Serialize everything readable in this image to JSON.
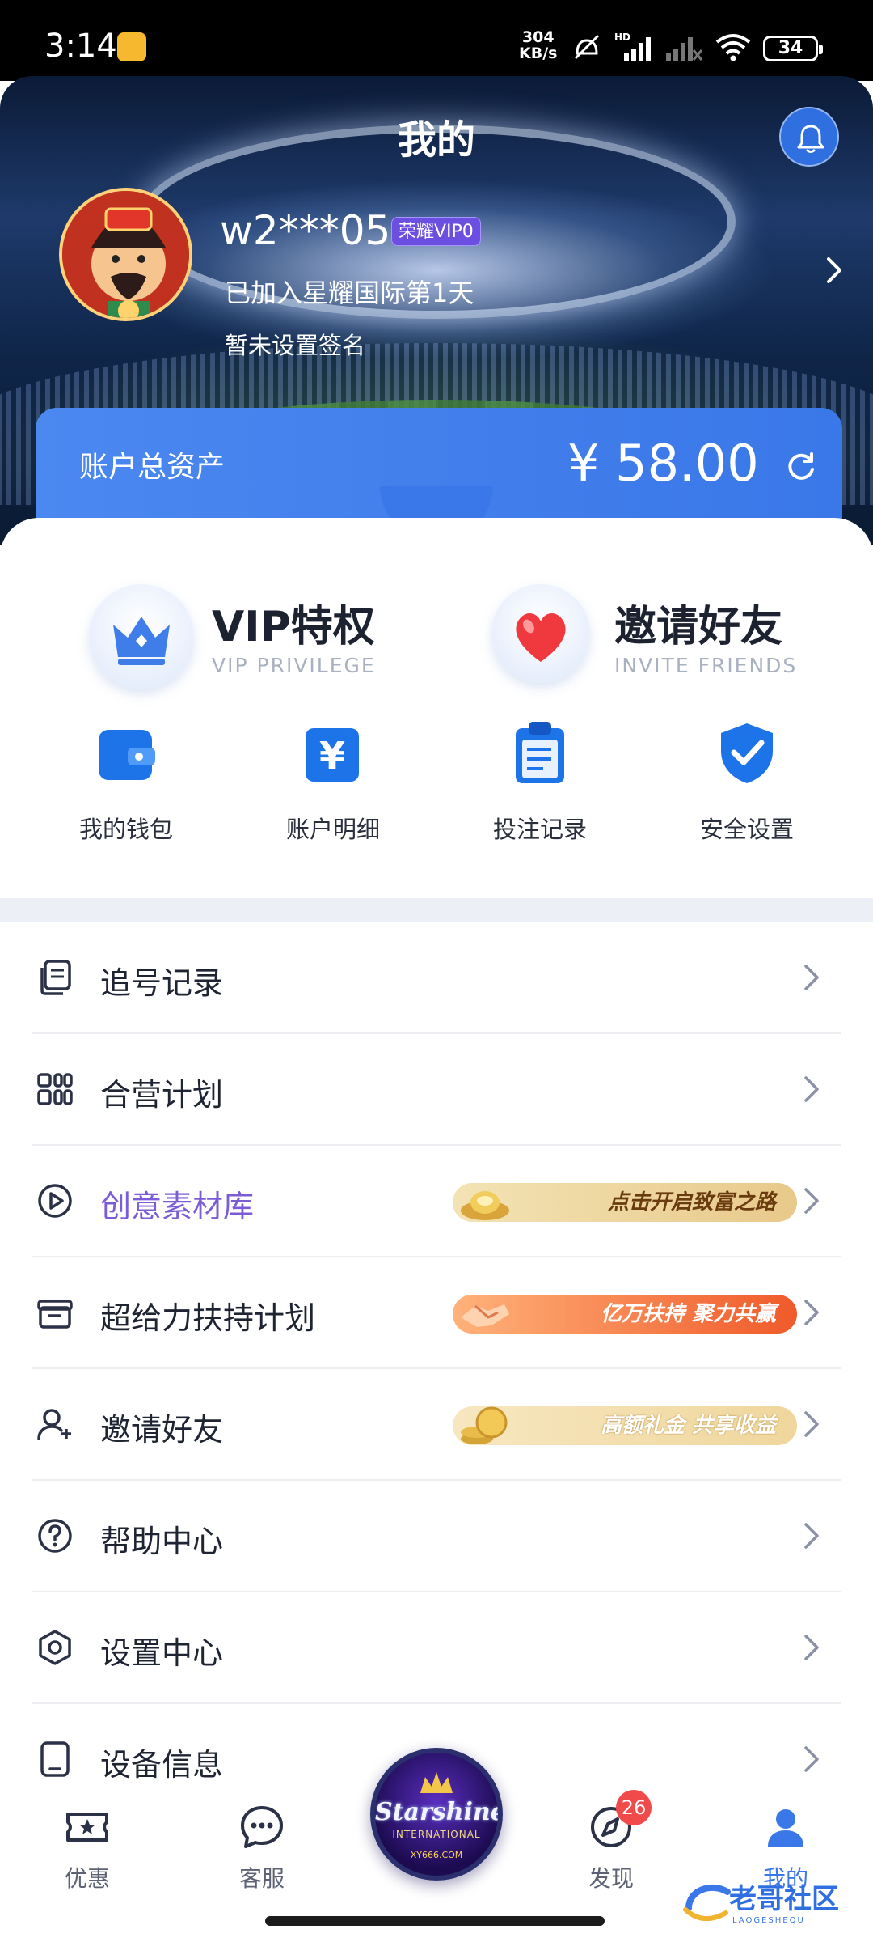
{
  "status_bar": {
    "time": "3:14",
    "speed_value": "304",
    "speed_unit": "KB/s",
    "battery": "34"
  },
  "header": {
    "title": "我的",
    "username": "w2***05",
    "vip_badge": "荣耀VIP0",
    "joined": "已加入星耀国际第1天",
    "signature": "暂未设置签名"
  },
  "asset": {
    "label": "账户总资产",
    "value": "¥ 58.00"
  },
  "features": [
    {
      "title": "VIP特权",
      "subtitle": "VIP PRIVILEGE",
      "icon": "crown-icon"
    },
    {
      "title": "邀请好友",
      "subtitle": "INVITE FRIENDS",
      "icon": "heart-icon"
    }
  ],
  "shortcuts": [
    {
      "label": "我的钱包",
      "icon": "wallet-icon"
    },
    {
      "label": "账户明细",
      "icon": "yen-document-icon"
    },
    {
      "label": "投注记录",
      "icon": "clipboard-icon"
    },
    {
      "label": "安全设置",
      "icon": "shield-check-icon"
    }
  ],
  "menu": [
    {
      "label": "追号记录",
      "icon": "copy-list-icon"
    },
    {
      "label": "合营计划",
      "icon": "grid-icon"
    },
    {
      "label": "创意素材库",
      "icon": "play-circle-icon",
      "promo": "点击开启致富之路"
    },
    {
      "label": "超给力扶持计划",
      "icon": "gift-box-icon",
      "promo": "亿万扶持 聚力共赢"
    },
    {
      "label": "邀请好友",
      "icon": "add-user-icon",
      "promo": "高额礼金 共享收益"
    },
    {
      "label": "帮助中心",
      "icon": "question-circle-icon"
    },
    {
      "label": "设置中心",
      "icon": "hexagon-settings-icon"
    },
    {
      "label": "设备信息",
      "icon": "tablet-icon"
    }
  ],
  "bottom_nav": {
    "items": [
      {
        "label": "优惠",
        "icon": "ticket-star-icon"
      },
      {
        "label": "客服",
        "icon": "chat-bubble-icon"
      },
      {
        "label": "发现",
        "icon": "compass-icon",
        "badge": "26"
      },
      {
        "label": "我的",
        "icon": "person-icon"
      }
    ],
    "center_logo": {
      "brand": "Starshine",
      "sub": "INTERNATIONAL",
      "url": "XY666.COM"
    }
  },
  "watermark": {
    "text": "老哥社区",
    "sub": "LAOGESHEQU"
  },
  "colors": {
    "accent": "#3a77e8",
    "vip_badge": "#6b4fe0",
    "purple_text": "#7b5cd6",
    "badge_red": "#f04a4a"
  }
}
